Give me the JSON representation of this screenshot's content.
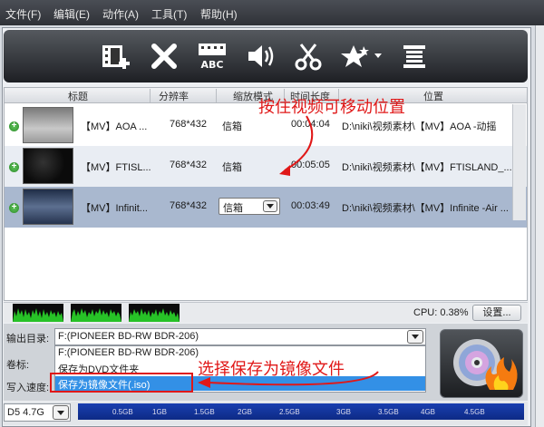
{
  "menu": [
    "文件(F)",
    "编辑(E)",
    "动作(A)",
    "工具(T)",
    "帮助(H)"
  ],
  "toolbar_icons": [
    "add-video-icon",
    "delete-icon",
    "subtitle-abc-icon",
    "audio-icon",
    "edit-scissors-icon",
    "effects-star-icon",
    "chapter-list-icon"
  ],
  "columns": {
    "title": "标题",
    "resolution": "分辨率",
    "scale": "缩放模式",
    "duration": "时间长度",
    "location": "位置"
  },
  "rows": [
    {
      "title": "【MV】AOA ...",
      "resolution": "768*432",
      "scale": "信箱",
      "duration": "00:04:04",
      "location": "D:\\niki\\视频素材\\【MV】AOA -动摇"
    },
    {
      "title": "【MV】FTISL...",
      "resolution": "768*432",
      "scale": "信箱",
      "duration": "00:05:05",
      "location": "D:\\niki\\视频素材\\【MV】FTISLAND_..."
    },
    {
      "title": "【MV】Infinit...",
      "resolution": "768*432",
      "scale": "信箱",
      "duration": "00:03:49",
      "location": "D:\\niki\\视频素材\\【MV】Infinite -Air ..."
    }
  ],
  "annotations": {
    "move": "按住视频可移动位置",
    "iso": "选择保存为镜像文件"
  },
  "cpu": "CPU: 0.38%",
  "settings_label": "设置...",
  "output": {
    "label": "输出目录:",
    "value": "F:(PIONEER BD-RW   BDR-206)",
    "options": [
      "F:(PIONEER BD-RW   BDR-206)",
      "保存为DVD文件夹",
      "保存为镜像文件(.iso)"
    ]
  },
  "volume_label": "卷标:",
  "speed_label": "写入速度:",
  "disc_type": "D5 4.7G",
  "capacity_ticks": [
    "0.5GB",
    "1GB",
    "1.5GB",
    "2GB",
    "2.5GB",
    "3GB",
    "3.5GB",
    "4GB",
    "4.5GB"
  ],
  "colors": {
    "annotation": "#e01818",
    "selected_row": "#a9b8cf",
    "capacity_bar": "#1a3fb0"
  }
}
